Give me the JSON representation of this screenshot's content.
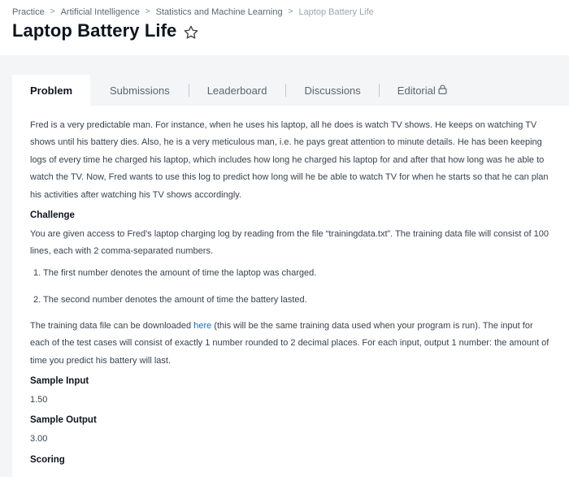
{
  "breadcrumb": {
    "items": [
      "Practice",
      "Artificial Intelligence",
      "Statistics and Machine Learning",
      "Laptop Battery Life"
    ],
    "separator": ">"
  },
  "title": "Laptop Battery Life",
  "tabs": [
    "Problem",
    "Submissions",
    "Leaderboard",
    "Discussions",
    "Editorial"
  ],
  "content": {
    "intro": "Fred is a very predictable man. For instance, when he uses his laptop, all he does is watch TV shows. He keeps on watching TV shows until his battery dies. Also, he is a very meticulous man, i.e. he pays great attention to minute details. He has been keeping logs of every time he charged his laptop, which includes how long he charged his laptop for and after that how long was he able to watch the TV. Now, Fred wants to use this log to predict how long will he be able to watch TV for when he starts so that he can plan his activities after watching his TV shows accordingly.",
    "challenge_heading": "Challenge",
    "challenge_text": "You are given access to Fred's laptop charging log by reading from the file “trainingdata.txt”. The training data file will consist of 100 lines, each with 2 comma-separated numbers.",
    "list": [
      "1. The first number denotes the amount of time the laptop was charged.",
      "2. The second number denotes the amount of time the battery lasted."
    ],
    "download_pre": "The training data file can be downloaded ",
    "download_link": "here",
    "download_post": " (this will be the same training data used when your program is run). The input for each of the test cases will consist of exactly 1 number rounded to 2 decimal places. For each input, output 1 number: the amount of time you predict his battery will last.",
    "sample_input_heading": "Sample Input",
    "sample_input": "1.50",
    "sample_output_heading": "Sample Output",
    "sample_output": "3.00",
    "scoring_heading": "Scoring"
  },
  "icons": {
    "star": "star-outline-icon",
    "lock": "lock-icon"
  },
  "colors": {
    "link": "#1a6fb0",
    "title": "#0e141e",
    "text": "#39424e"
  }
}
